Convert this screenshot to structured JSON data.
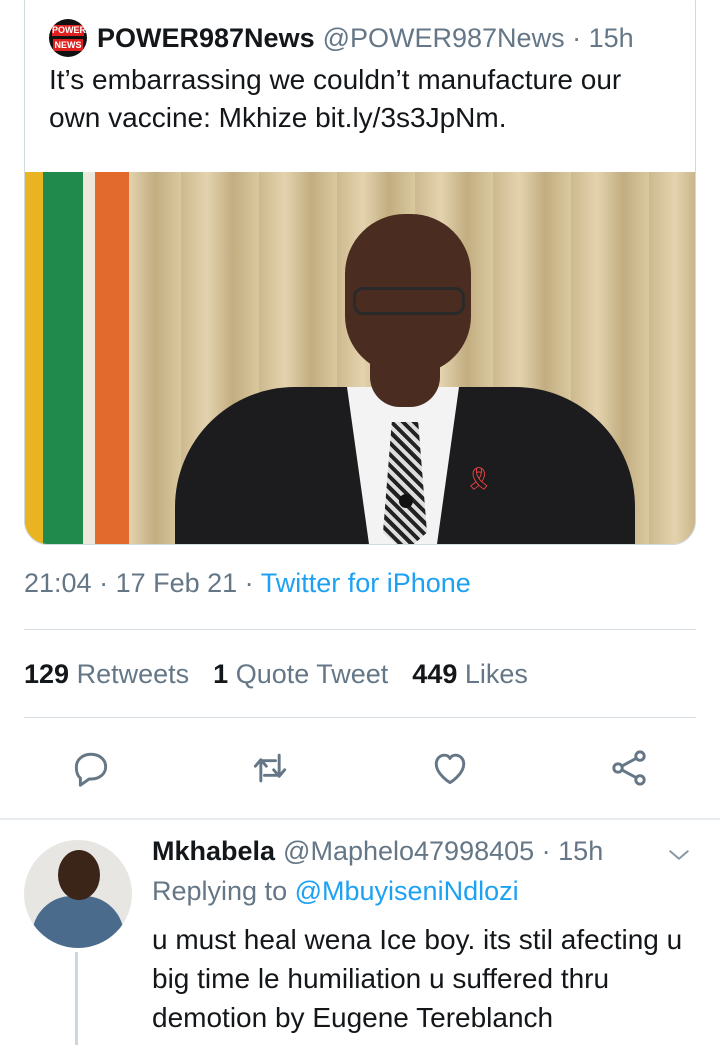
{
  "quoted_tweet": {
    "author_name": "POWER987News",
    "author_handle": "@POWER987News",
    "time_ago": "15h",
    "text": "It’s embarrassing we couldn’t manufacture our own vaccine: Mkhize bit.ly/3s3JpNm.",
    "logo_text_top": "POWER",
    "logo_text_bottom": "NEWS"
  },
  "tweet_meta": {
    "time": "21:04",
    "date": "17 Feb 21",
    "source": "Twitter for iPhone"
  },
  "stats": {
    "retweets_count": "129",
    "retweets_label": "Retweets",
    "quotes_count": "1",
    "quotes_label": "Quote Tweet",
    "likes_count": "449",
    "likes_label": "Likes"
  },
  "actions": [
    {
      "icon": "reply-icon"
    },
    {
      "icon": "retweet-icon"
    },
    {
      "icon": "heart-icon"
    },
    {
      "icon": "share-icon"
    }
  ],
  "reply": {
    "author_name": "Mkhabela",
    "author_handle": "@Maphelo47998405",
    "time_ago": "15h",
    "replying_prefix": "Replying to",
    "replying_to": "@MbuyiseniNdlozi",
    "text": "u must heal wena Ice boy. its stil afecting u big time le humiliation u suffered thru demotion by Eugene Tereblanch"
  },
  "colors": {
    "link": "#1da1f2",
    "muted": "#657786",
    "text": "#14171a",
    "icon": "#657786"
  }
}
